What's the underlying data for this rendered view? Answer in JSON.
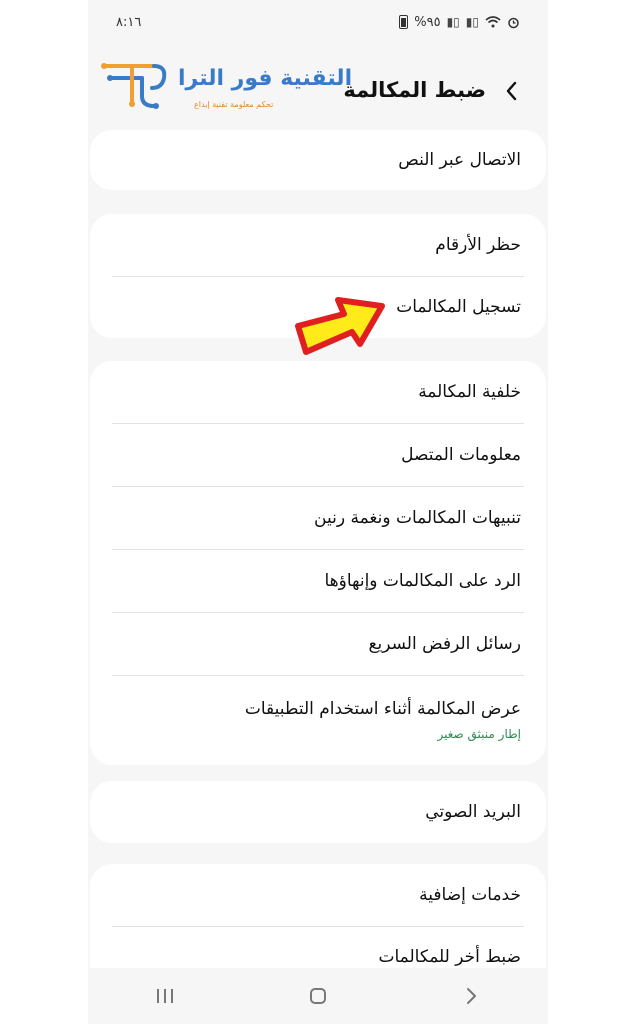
{
  "status_bar": {
    "time": "٨:١٦",
    "battery": "%٩٥"
  },
  "header": {
    "title": "ضبط المكالمة",
    "back_icon": "chevron-left-icon"
  },
  "watermark": {
    "name": "التقنية فور الترا",
    "tagline": "تحكم   معلومة   تقنية   إبداع"
  },
  "cards": [
    {
      "items": [
        {
          "title": "الاتصال عبر النص"
        }
      ]
    },
    {
      "items": [
        {
          "title": "حظر الأرقام"
        },
        {
          "title": "تسجيل المكالمات"
        }
      ]
    },
    {
      "items": [
        {
          "title": "خلفية المكالمة"
        },
        {
          "title": "معلومات المتصل"
        },
        {
          "title": "تنبيهات المكالمات ونغمة رنين"
        },
        {
          "title": "الرد على المكالمات وإنهاؤها"
        },
        {
          "title": "رسائل الرفض السريع"
        },
        {
          "title": "عرض المكالمة أثناء استخدام التطبيقات",
          "subtitle": "إطار منبثق صغير"
        }
      ]
    },
    {
      "items": [
        {
          "title": "البريد الصوتي"
        }
      ]
    },
    {
      "items": [
        {
          "title": "خدمات إضافية"
        },
        {
          "title": "ضبط أخر للمكالمات"
        }
      ]
    }
  ],
  "annotation": {
    "arrow_color": "#ffeb1a",
    "arrow_border": "#e02020"
  },
  "colors": {
    "accent_subtitle": "#2e8b57",
    "background": "#f6f6f6",
    "card": "#ffffff"
  }
}
